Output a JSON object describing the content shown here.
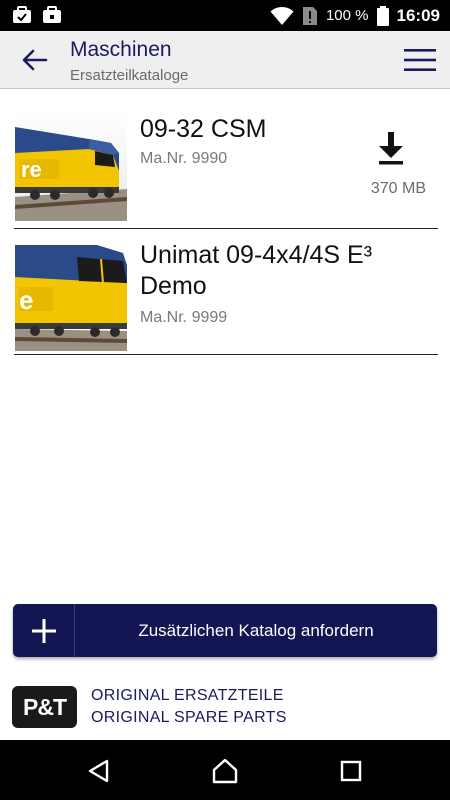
{
  "status_bar": {
    "battery": "100 %",
    "time": "16:09",
    "icons": [
      "work-profile-icon",
      "work-briefcase-icon",
      "wifi-icon",
      "no-sim-icon",
      "battery-icon"
    ]
  },
  "toolbar": {
    "title": "Maschinen",
    "subtitle": "Ersatzteilkataloge",
    "back_icon": "arrow-left-icon",
    "menu_icon": "hamburger-menu-icon"
  },
  "catalogs": [
    {
      "title": "09-32 CSM",
      "machine_no": "Ma.Nr. 9990",
      "download_size": "370 MB",
      "download_icon": "download-icon"
    },
    {
      "title": "Unimat 09-4x4/4S E³ Demo",
      "machine_no": "Ma.Nr. 9999"
    }
  ],
  "request_button": {
    "label": "Zusätzlichen Katalog anfordern",
    "icon": "plus-icon"
  },
  "brand": {
    "logo": "P&T",
    "line1": "ORIGINAL ERSATZTEILE",
    "line2": "ORIGINAL SPARE PARTS"
  },
  "nav_bar": {
    "icons": [
      "back-triangle-icon",
      "home-icon",
      "recents-square-icon"
    ]
  },
  "colors": {
    "primary": "#131653",
    "toolbar_bg": "#efefef",
    "title_text": "#1a1a5e",
    "machine_yellow": "#f2c500",
    "machine_blue": "#2a4a8a"
  }
}
